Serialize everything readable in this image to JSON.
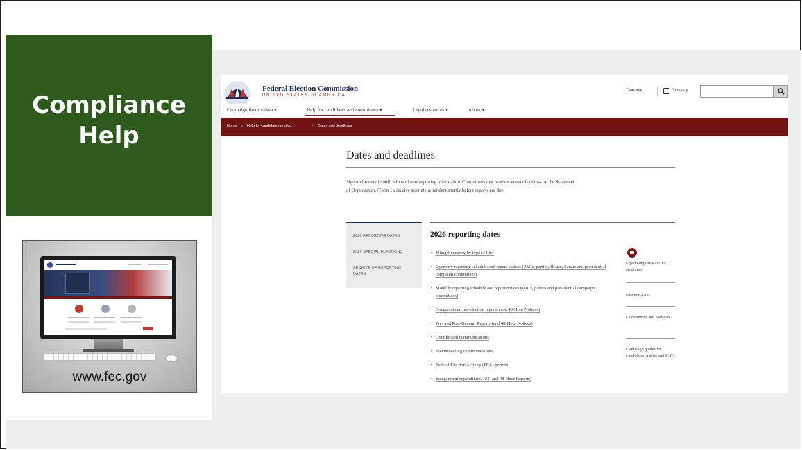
{
  "slide": {
    "title_line1": "Compliance",
    "title_line2": "Help",
    "url": "www.fec.gov"
  },
  "site": {
    "org_name": "Federal Election Commission",
    "org_subtitle": "UNITED STATES of AMERICA",
    "utility": {
      "calendar": "Calendar",
      "glossary": "Glossary",
      "search_placeholder": ""
    },
    "nav": [
      {
        "label": "Campaign finance data ▾"
      },
      {
        "label": "Help for candidates and committees ▾"
      },
      {
        "label": "Legal resources ▾"
      },
      {
        "label": "About ▾"
      }
    ],
    "breadcrumb": {
      "home": "Home",
      "level1": "Help for candidates and co...",
      "current": "Dates and deadlines",
      "sep": "›"
    },
    "page_title": "Dates and deadlines",
    "intro": "Sign up for email notifications of new reporting information. Committees that provide an email address on the Statement of Organization (Form 1), receive separate reminders shortly before reports are due.",
    "side_nav": [
      {
        "label": "2026 REPORTING DATES"
      },
      {
        "label": "2026 SPECIAL ELECTIONS"
      },
      {
        "label": "ARCHIVE OF REPORTING DATES"
      }
    ],
    "section_title": "2026 reporting dates",
    "bullets": [
      "Filing frequency by type of filer",
      "Quarterly reporting schedule and report notices (PACs, parties, House, Senate and presidential campaign committees)",
      "Monthly reporting schedule and report notices (PACs, parties and presidential campaign committees)",
      "Congressional pre-election reports (and 48-Hour Notices)",
      "Pre- and Post-General Reports (and 48-Hour Notices)",
      "Coordinated communications",
      "Electioneering communications",
      "Federal Election Activity (FEA) periods",
      "Independent expenditures (24- and 48-Hour Reports)"
    ],
    "related": [
      "Upcoming dates and FEC deadlines",
      "Election dates",
      "Conferences and webinars",
      "Campaign guides for candidates, parties and PACs"
    ]
  },
  "colors": {
    "title_box": "#2e5b1d",
    "breadcrumb_bar": "#6e1414",
    "accent_red": "#9b1c1c",
    "navy": "#1c2f61"
  },
  "icons": [
    "fec-seal-icon",
    "glossary-book-icon",
    "search-icon",
    "calendar-icon",
    "computer-monitor-illustration"
  ]
}
